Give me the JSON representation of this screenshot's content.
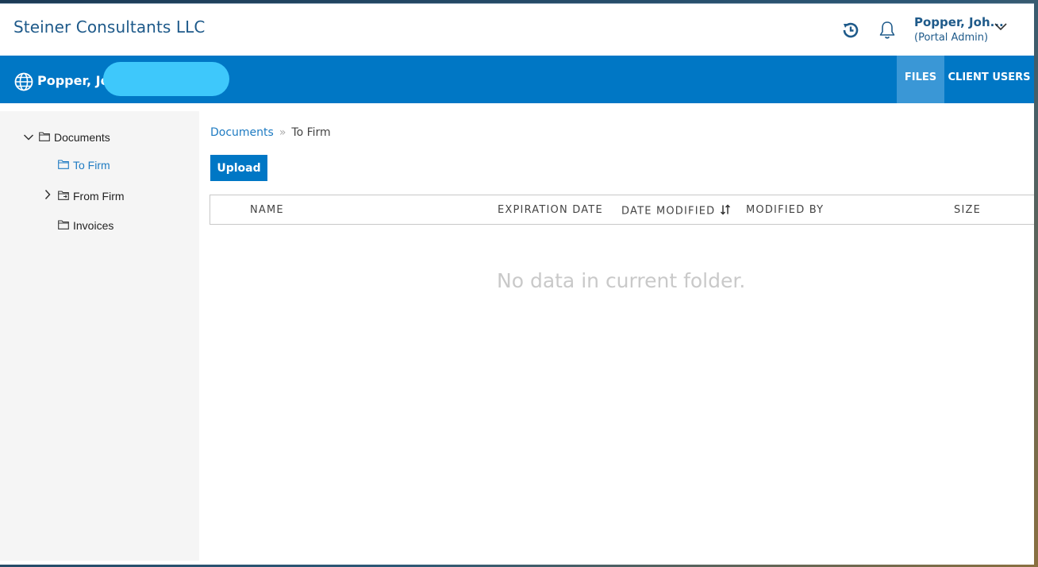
{
  "header": {
    "firm_name": "Steiner Consultants LLC",
    "user_name": "Popper, Joh...",
    "user_role": "(Portal Admin)",
    "icons": [
      "history-icon",
      "bell-icon",
      "chevron-down-icon"
    ]
  },
  "client_bar": {
    "client_name": "Popper, Joh",
    "tabs": [
      {
        "label": "FILES",
        "active": true
      },
      {
        "label": "CLIENT USERS",
        "active": false
      }
    ]
  },
  "tree": {
    "items": [
      {
        "label": "Documents",
        "expanded": true
      },
      {
        "label": "To Firm",
        "selected": true
      },
      {
        "label": "From Firm",
        "expanded": false
      },
      {
        "label": "Invoices"
      }
    ]
  },
  "breadcrumb": {
    "root": "Documents",
    "separator": "»",
    "current": "To Firm"
  },
  "toolbar": {
    "upload_label": "Upload"
  },
  "table": {
    "columns": [
      "NAME",
      "EXPIRATION DATE",
      "DATE MODIFIED",
      "MODIFIED BY",
      "SIZE"
    ],
    "sorted_column": "DATE MODIFIED",
    "empty_message": "No data in current folder."
  },
  "colors": {
    "brand_blue": "#0077c5",
    "active_tab": "#3a97d6",
    "link_blue": "#1e7bc2",
    "header_text": "#1e5a8a"
  }
}
